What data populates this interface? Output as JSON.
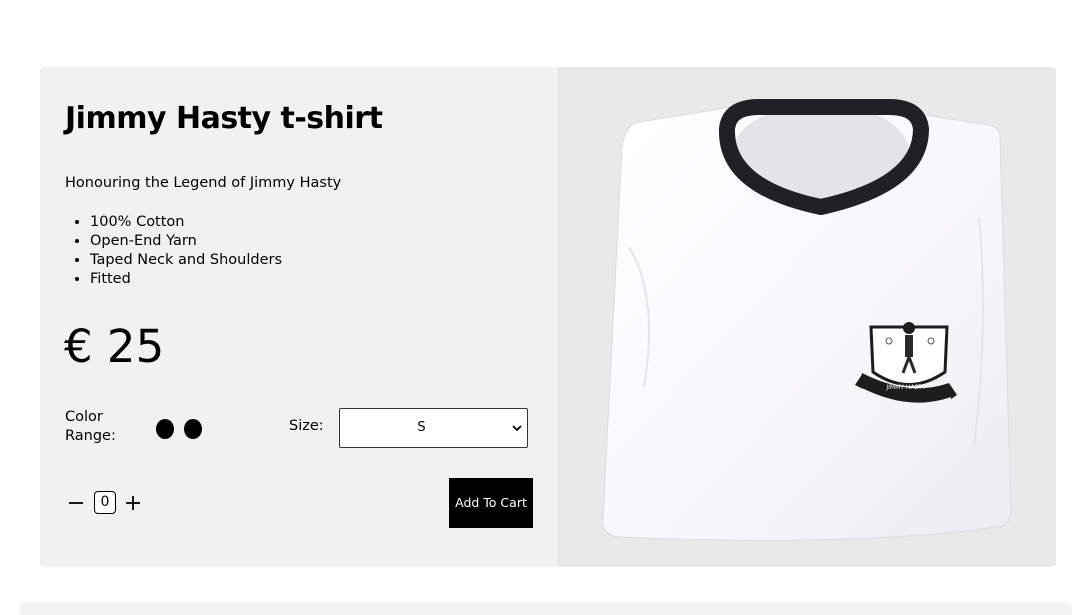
{
  "product": {
    "title": "Jimmy Hasty t-shirt",
    "subtitle": "Honouring the Legend of Jimmy Hasty",
    "features": [
      "100% Cotton",
      "Open-End Yarn",
      "Taped Neck and Shoulders",
      "Fitted"
    ],
    "price": "€ 25",
    "color_label": "Color Range:",
    "colors": [
      "#000000",
      "#000000"
    ],
    "size_label": "Size:",
    "size_value": "S",
    "quantity": "0",
    "add_to_cart_label": "Add To Cart",
    "crest_text": "JIMMY HASTY"
  }
}
